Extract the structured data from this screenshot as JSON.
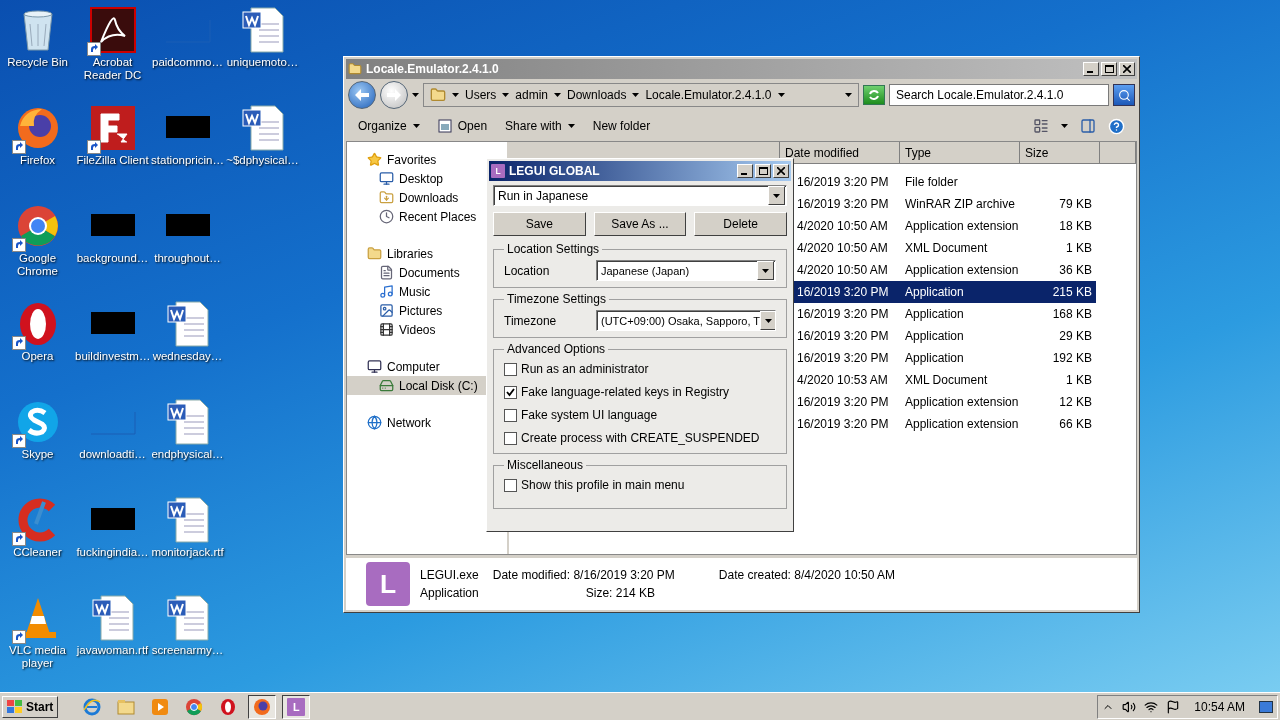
{
  "desktop_icons": [
    {
      "label": "Recycle Bin",
      "kind": "recycle",
      "shortcut": false
    },
    {
      "label": "Firefox",
      "kind": "firefox",
      "shortcut": true
    },
    {
      "label": "Google Chrome",
      "kind": "chrome",
      "shortcut": true
    },
    {
      "label": "Opera",
      "kind": "opera",
      "shortcut": true
    },
    {
      "label": "Skype",
      "kind": "skype",
      "shortcut": true
    },
    {
      "label": "CCleaner",
      "kind": "ccleaner",
      "shortcut": true
    },
    {
      "label": "VLC media player",
      "kind": "vlc",
      "shortcut": true
    },
    {
      "label": "Acrobat Reader DC",
      "kind": "acrobat",
      "shortcut": true
    },
    {
      "label": "FileZilla Client",
      "kind": "filezilla",
      "shortcut": true
    },
    {
      "label": "background…",
      "kind": "redacted",
      "shortcut": false
    },
    {
      "label": "buildinvestm…",
      "kind": "redacted",
      "shortcut": false
    },
    {
      "label": "downloadti…",
      "kind": "blank",
      "shortcut": false
    },
    {
      "label": "fuckingindia…",
      "kind": "redacted",
      "shortcut": false
    },
    {
      "label": "javawoman.rtf",
      "kind": "word",
      "shortcut": false
    },
    {
      "label": "paidcommo…",
      "kind": "blank",
      "shortcut": false
    },
    {
      "label": "stationpricin…",
      "kind": "redacted",
      "shortcut": false
    },
    {
      "label": "throughout…",
      "kind": "redacted",
      "shortcut": false
    },
    {
      "label": "wednesday…",
      "kind": "word",
      "shortcut": false
    },
    {
      "label": "endphysical…",
      "kind": "word",
      "shortcut": false
    },
    {
      "label": "monitorjack.rtf",
      "kind": "word",
      "shortcut": false
    },
    {
      "label": "screenarmy…",
      "kind": "word",
      "shortcut": false
    },
    {
      "label": "uniquemoto…",
      "kind": "word",
      "shortcut": false
    },
    {
      "label": "~$dphysical…",
      "kind": "word",
      "shortcut": false
    }
  ],
  "explorer": {
    "title": "Locale.Emulator.2.4.1.0",
    "breadcrumb": [
      "Users",
      "admin",
      "Downloads",
      "Locale.Emulator.2.4.1.0"
    ],
    "search": {
      "placeholder": "Search Locale.Emulator.2.4.1.0"
    },
    "toolbar": [
      {
        "label": "Organize",
        "kind": "menu"
      },
      {
        "label": "Open",
        "kind": "icon"
      },
      {
        "label": "Share with",
        "kind": "menu"
      },
      {
        "label": "New folder",
        "kind": "plain"
      }
    ],
    "nav": [
      {
        "label": "Favorites",
        "selected": false,
        "children": [
          {
            "label": "Desktop",
            "selected": false
          },
          {
            "label": "Downloads",
            "selected": false
          },
          {
            "label": "Recent Places",
            "selected": false
          }
        ]
      },
      {
        "label": "Libraries",
        "selected": false,
        "children": [
          {
            "label": "Documents",
            "selected": false
          },
          {
            "label": "Music",
            "selected": false
          },
          {
            "label": "Pictures",
            "selected": false
          },
          {
            "label": "Videos",
            "selected": false
          }
        ]
      },
      {
        "label": "Computer",
        "selected": false,
        "children": [
          {
            "label": "Local Disk (C:)",
            "selected": true
          }
        ]
      },
      {
        "label": "Network",
        "selected": false
      }
    ],
    "columns": [
      "Date modified",
      "Type",
      "Size"
    ],
    "rows": [
      {
        "date": "16/2019 3:20 PM",
        "type": "File folder",
        "selected": false
      },
      {
        "date": "16/2019 3:20 PM",
        "type": "WinRAR ZIP archive",
        "size": "79 KB",
        "selected": false
      },
      {
        "date": "4/2020 10:50 AM",
        "type": "Application extension",
        "size": "18 KB",
        "selected": false
      },
      {
        "date": "4/2020 10:50 AM",
        "type": "XML Document",
        "size": "1 KB",
        "selected": false
      },
      {
        "date": "4/2020 10:50 AM",
        "type": "Application extension",
        "size": "36 KB",
        "selected": false
      },
      {
        "date": "16/2019 3:20 PM",
        "type": "Application",
        "size": "215 KB",
        "selected": true
      },
      {
        "date": "16/2019 3:20 PM",
        "type": "Application",
        "size": "168 KB",
        "selected": false
      },
      {
        "date": "16/2019 3:20 PM",
        "type": "Application",
        "size": "29 KB",
        "selected": false
      },
      {
        "date": "16/2019 3:20 PM",
        "type": "Application",
        "size": "192 KB",
        "selected": false
      },
      {
        "date": "4/2020 10:53 AM",
        "type": "XML Document",
        "size": "1 KB",
        "selected": false
      },
      {
        "date": "16/2019 3:20 PM",
        "type": "Application extension",
        "size": "12 KB",
        "selected": false
      },
      {
        "date": "16/2019 3:20 PM",
        "type": "Application extension",
        "size": "66 KB",
        "selected": false
      }
    ],
    "details": {
      "icon_letter": "L",
      "name": "LEGUI.exe",
      "type": "Application",
      "fields": [
        {
          "label": "Date modified:",
          "value": "8/16/2019 3:20 PM"
        },
        {
          "label": "Date created:",
          "value": "8/4/2020 10:50 AM"
        },
        {
          "label": "Size:",
          "value": "214 KB"
        }
      ]
    }
  },
  "dialog": {
    "icon_letter": "L",
    "title": "LEGUI GLOBAL",
    "profile": "Run in Japanese",
    "buttons": [
      "Save",
      "Save As ...",
      "Delete"
    ],
    "groups": [
      {
        "title": "Location Settings",
        "kind": "select",
        "label": "Location",
        "value": "Japanese (Japan)"
      },
      {
        "title": "Timezone Settings",
        "kind": "select",
        "label": "Timezone",
        "value": "(UTC+09:00) Osaka, Sapporo, T"
      },
      {
        "title": "Advanced Options",
        "kind": "checks",
        "options": [
          {
            "label": "Run as an administrator",
            "checked": false
          },
          {
            "label": "Fake language-related keys in Registry",
            "checked": true
          },
          {
            "label": "Fake system UI language",
            "checked": false
          },
          {
            "label": "Create process with CREATE_SUSPENDED",
            "checked": false
          }
        ]
      },
      {
        "title": "Miscellaneous",
        "kind": "checks",
        "options": [
          {
            "label": "Show this profile in main menu",
            "checked": false
          }
        ]
      }
    ]
  },
  "taskbar": {
    "start": "Start",
    "apps": [
      {
        "kind": "ie",
        "pressed": false
      },
      {
        "kind": "explorer",
        "pressed": false
      },
      {
        "kind": "media",
        "pressed": false
      },
      {
        "kind": "chrome",
        "pressed": false
      },
      {
        "kind": "opera",
        "pressed": false
      },
      {
        "kind": "firefox",
        "pressed": true
      },
      {
        "kind": "legui",
        "pressed": true,
        "letter": "L"
      }
    ],
    "time": "10:54 AM"
  }
}
